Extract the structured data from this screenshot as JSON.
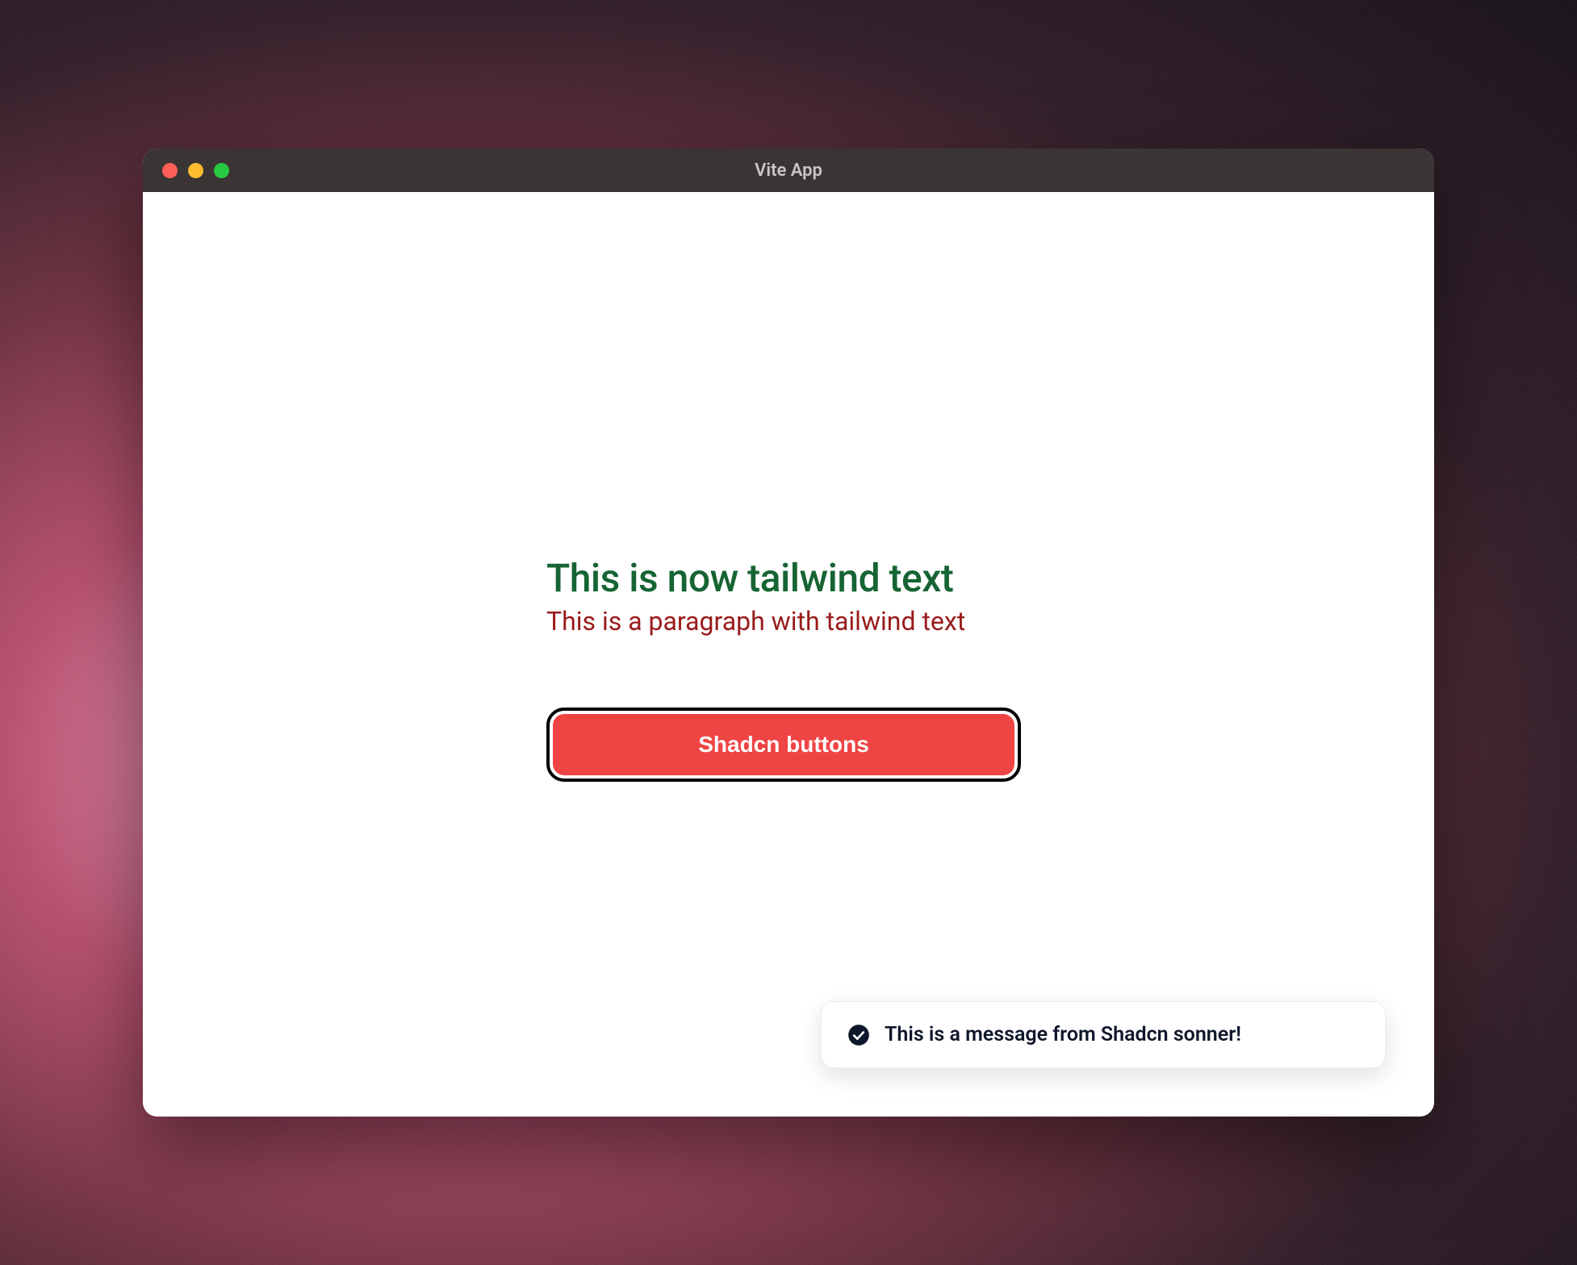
{
  "window": {
    "title": "Vite App"
  },
  "content": {
    "heading": "This is now tailwind text",
    "paragraph": "This is a paragraph with tailwind text",
    "button_label": "Shadcn buttons"
  },
  "toast": {
    "icon": "check-circle-icon",
    "message": "This is a message from Shadcn sonner!"
  },
  "colors": {
    "heading": "#166433",
    "paragraph": "#991b1b",
    "button_bg": "#ef4444",
    "button_text": "#ffffff",
    "toast_icon": "#0f172a"
  }
}
